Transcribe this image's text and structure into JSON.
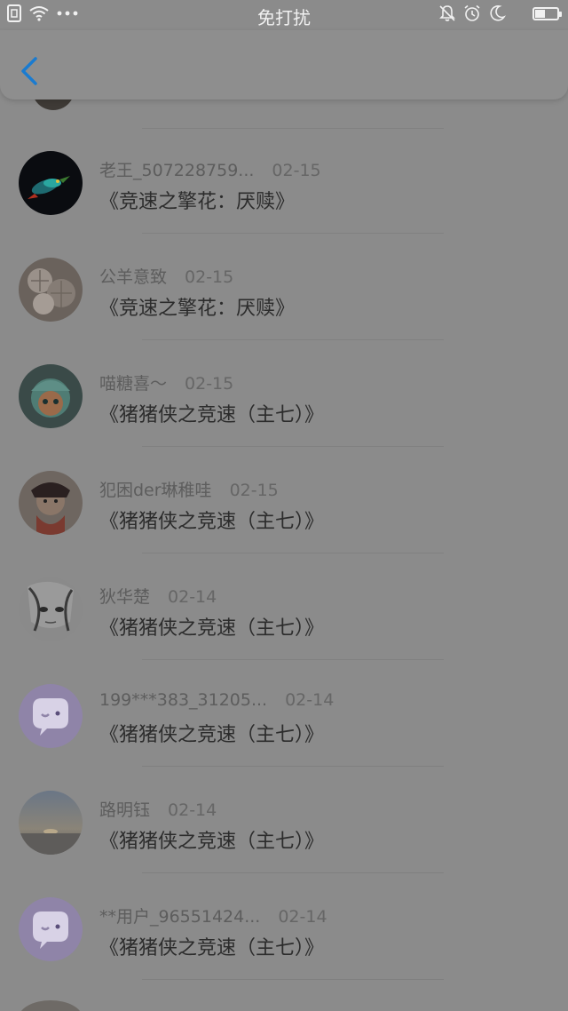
{
  "status_bar": {
    "title": "免打扰",
    "left_icons": [
      "sim-icon",
      "wifi-icon",
      "more-dots-icon"
    ],
    "right_icons": [
      "mute-bell-icon",
      "alarm-icon",
      "moon-icon",
      "battery-icon"
    ],
    "battery_level": 0.45
  },
  "nav": {
    "back_icon": "chevron-left-icon",
    "accent": "#1a7bd0"
  },
  "items": [
    {
      "name": "老王_507228759...",
      "date": "02-15",
      "title": "《竞速之擎花：厌赎》",
      "avatar": "bird"
    },
    {
      "name": "公羊意致",
      "date": "02-15",
      "title": "《竞速之擎花：厌赎》",
      "avatar": "shells"
    },
    {
      "name": "喵糖喜～",
      "date": "02-15",
      "title": "《猪猪侠之竞速（主七）》",
      "avatar": "teal-girl"
    },
    {
      "name": "犯困der琳稚哇",
      "date": "02-15",
      "title": "《猪猪侠之竞速（主七）》",
      "avatar": "red-girl"
    },
    {
      "name": "狄华楚",
      "date": "02-14",
      "title": "《猪猪侠之竞速（主七）》",
      "avatar": "sketch"
    },
    {
      "name": "199***383_31205...",
      "date": "02-14",
      "title": "《猪猪侠之竞速（主七）》",
      "avatar": "default"
    },
    {
      "name": "路明钰",
      "date": "02-14",
      "title": "《猪猪侠之竞速（主七）》",
      "avatar": "sunset"
    },
    {
      "name": "**用户_96551424...",
      "date": "02-14",
      "title": "《猪猪侠之竞速（主七）》",
      "avatar": "default"
    }
  ]
}
